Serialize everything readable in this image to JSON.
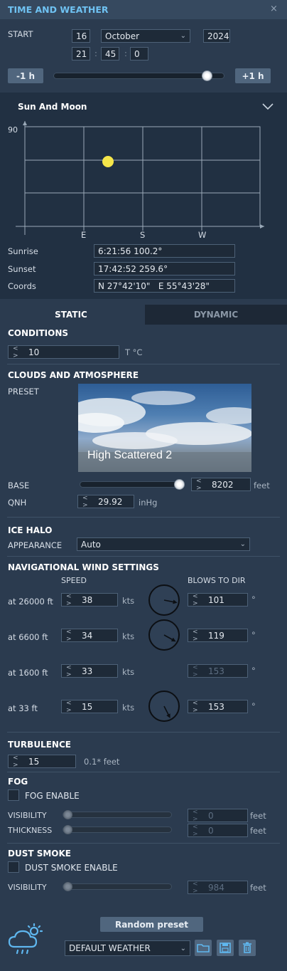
{
  "window": {
    "title": "TIME AND WEATHER",
    "close": "×"
  },
  "start": {
    "label": "START",
    "day": "16",
    "month": "October",
    "year": "2024",
    "hour": "21",
    "minute": "45",
    "second": "0",
    "sep": ":"
  },
  "time_controls": {
    "minus": "-1 h",
    "plus": "+1 h",
    "slider_fraction": 0.9
  },
  "sun_moon": {
    "title": "Sun And Moon",
    "y_max_label": "90",
    "compass": [
      "E",
      "S",
      "W"
    ],
    "sunrise_label": "Sunrise",
    "sunrise": "6:21:56 100.2°",
    "sunset_label": "Sunset",
    "sunset": "17:42:52 259.6°",
    "coords_label": "Coords",
    "coords": "N 27°42'10\"   E 55°43'28\""
  },
  "tabs": {
    "static": "STATIC",
    "dynamic": "DYNAMIC"
  },
  "conditions": {
    "title": "CONDITIONS",
    "temp": "10",
    "temp_unit": "T °C"
  },
  "clouds": {
    "title": "CLOUDS AND ATMOSPHERE",
    "preset_label": "PRESET",
    "preset_name": "High Scattered 2",
    "base_label": "BASE",
    "base_value": "8202",
    "base_unit": "feet",
    "base_slider_fraction": 0.95,
    "qnh_label": "QNH",
    "qnh_value": "29.92",
    "qnh_unit": "inHg"
  },
  "ice_halo": {
    "title": "ICE HALO",
    "appearance_label": "APPEARANCE",
    "appearance_value": "Auto"
  },
  "wind": {
    "title": "NAVIGATIONAL WIND SETTINGS",
    "speed_header": "SPEED",
    "dir_header": "BLOWS TO DIR",
    "unit": "kts",
    "deg": "°",
    "rows": [
      {
        "label": "at 26000 ft",
        "speed": "38",
        "dir": "101",
        "dir_deg": 101,
        "dial": true,
        "dim": false
      },
      {
        "label": "at 6600 ft",
        "speed": "34",
        "dir": "119",
        "dir_deg": 119,
        "dial": true,
        "dim": false
      },
      {
        "label": "at 1600 ft",
        "speed": "33",
        "dir": "153",
        "dir_deg": 153,
        "dial": false,
        "dim": true
      },
      {
        "label": "at 33 ft",
        "speed": "15",
        "dir": "153",
        "dir_deg": 153,
        "dial": true,
        "dim": false
      }
    ]
  },
  "turbulence": {
    "title": "TURBULENCE",
    "value": "15",
    "unit": "0.1* feet"
  },
  "fog": {
    "title": "FOG",
    "enable_label": "FOG ENABLE",
    "visibility_label": "VISIBILITY",
    "visibility": "0",
    "thickness_label": "THICKNESS",
    "thickness": "0",
    "unit": "feet"
  },
  "dust": {
    "title": "DUST SMOKE",
    "enable_label": "DUST SMOKE ENABLE",
    "visibility_label": "VISIBILITY",
    "visibility": "984",
    "unit": "feet"
  },
  "footer": {
    "random_preset": "Random preset",
    "preset_select": "DEFAULT WEATHER"
  },
  "colors": {
    "accent": "#6fc2f2",
    "sun": "#f5e64a",
    "grid": "#9aa9b8"
  }
}
